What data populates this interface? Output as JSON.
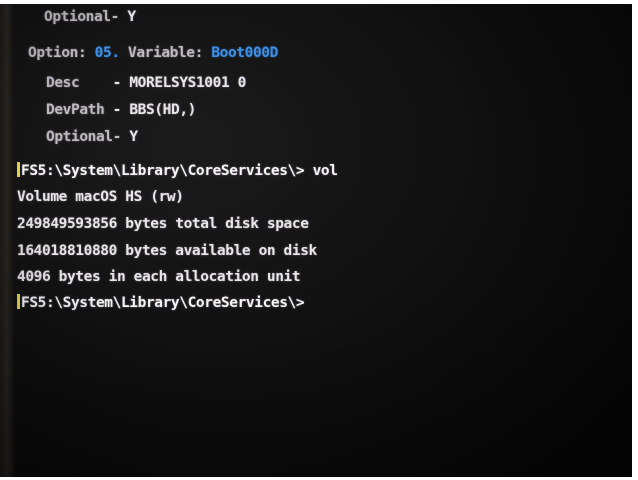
{
  "terminal": {
    "lines": {
      "optional_1": {
        "label": "Optional-",
        "value": "Y"
      },
      "option": {
        "label": "Option:",
        "number": "05.",
        "variable_label": "Variable:",
        "variable_value": "Boot000D"
      },
      "desc": {
        "label": "Desc",
        "separator": "-",
        "value": "MORELSYS1001 0"
      },
      "devpath": {
        "label": "DevPath",
        "separator": "-",
        "value": "BBS(HD,)"
      },
      "optional_2": {
        "label": "Optional-",
        "value": "Y"
      },
      "command": {
        "prompt": "FS5:\\System\\Library\\CoreServices\\>",
        "input": "vol"
      },
      "volume": "Volume macOS HS (rw)",
      "total_space": "249849593856 bytes total disk space",
      "available": "164018810880 bytes available on disk",
      "allocation": "4096 bytes in each allocation unit",
      "prompt_final": "FS5:\\System\\Library\\CoreServices\\>"
    }
  },
  "colors": {
    "text": "#e8e6ec",
    "highlight": "#3e8fe8",
    "background": "#0e0e0e"
  }
}
